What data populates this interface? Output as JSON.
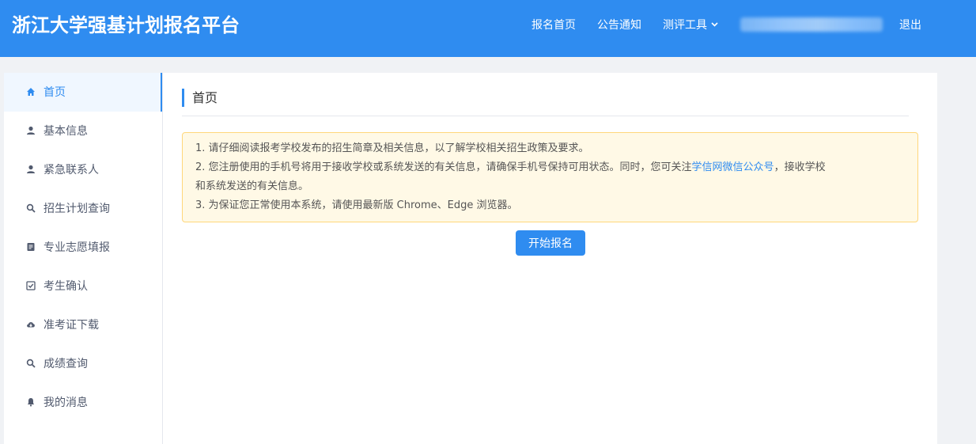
{
  "header": {
    "title": "浙江大学强基计划报名平台",
    "nav": [
      {
        "label": "报名首页"
      },
      {
        "label": "公告通知"
      },
      {
        "label": "测评工具"
      },
      {
        "label": "退出"
      }
    ]
  },
  "sidebar": {
    "items": [
      {
        "label": "首页",
        "icon": "home-icon",
        "active": true
      },
      {
        "label": "基本信息",
        "icon": "user-icon"
      },
      {
        "label": "紧急联系人",
        "icon": "user-icon"
      },
      {
        "label": "招生计划查询",
        "icon": "search-icon"
      },
      {
        "label": "专业志愿填报",
        "icon": "document-icon"
      },
      {
        "label": "考生确认",
        "icon": "checkbox-icon"
      },
      {
        "label": "准考证下载",
        "icon": "cloud-download-icon"
      },
      {
        "label": "成绩查询",
        "icon": "search-icon"
      },
      {
        "label": "我的消息",
        "icon": "bell-icon"
      }
    ]
  },
  "main": {
    "title": "首页",
    "notice": {
      "line1": "1. 请仔细阅读报考学校发布的招生简章及相关信息，以了解学校相关招生政策及要求。",
      "line2_pre": "2. 您注册使用的手机号将用于接收学校或系统发送的有关信息，请确保手机号保持可用状态。同时，您可关注",
      "line2_link": "学信网微信公众号",
      "line2_post": "，接收学校",
      "line2_cont": "和系统发送的有关信息。",
      "line3": "3. 为保证您正常使用本系统，请使用最新版 Chrome、Edge 浏览器。"
    },
    "start_button": "开始报名"
  },
  "colors": {
    "primary": "#2f8cf0",
    "notice_bg": "#fff9e6",
    "notice_border": "#ffd77a"
  }
}
